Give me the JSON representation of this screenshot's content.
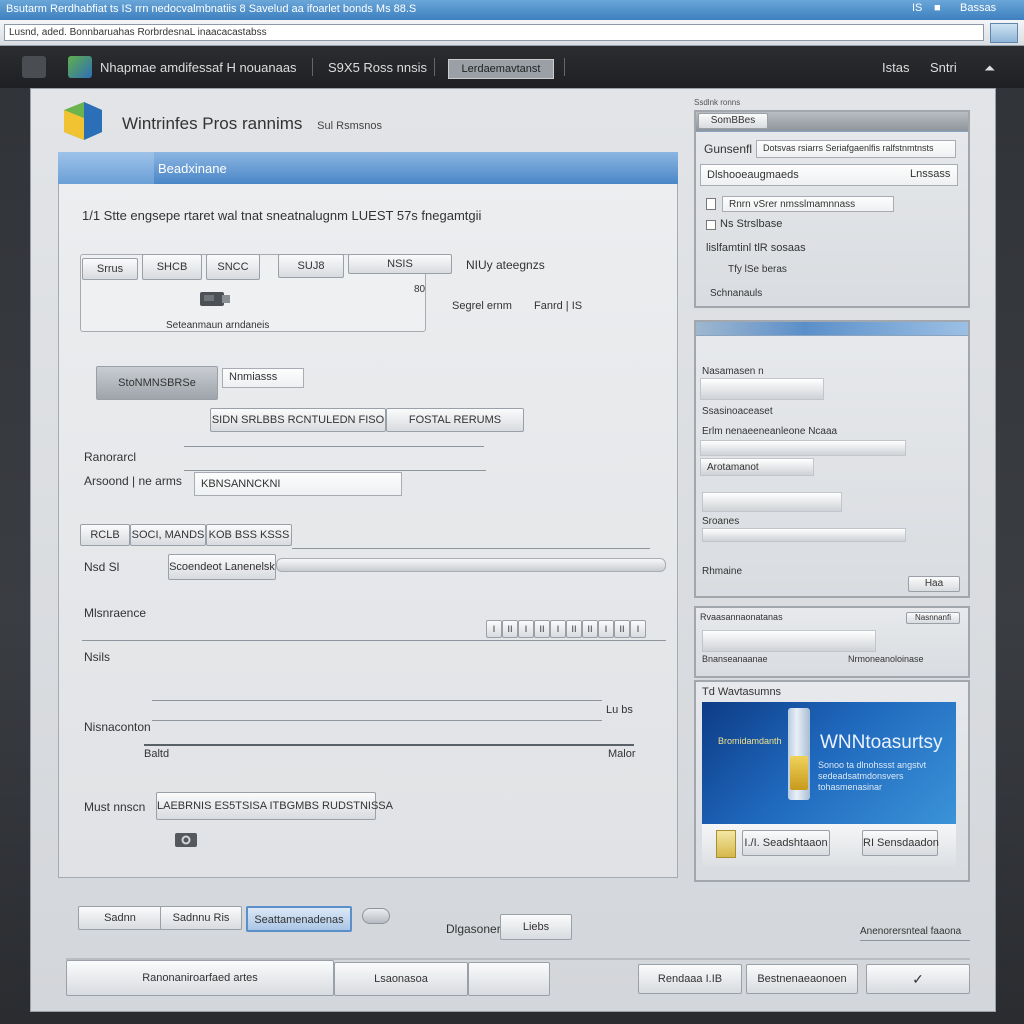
{
  "window": {
    "title": "Bsutarm Rerdhabfiat ts IS rrn nedocvalmbnatiis 8 Savelud aa ifoarlet bonds Ms 88.S",
    "controls": [
      "IS",
      "■",
      "Bassas"
    ],
    "address": "Lusnd, aded. Bonnbaruahas RorbrdesnaL inaacacastabss"
  },
  "toolbar": {
    "app_label": "Nhapmae amdifessaf  H nouanaas",
    "item2": "S9X5 Ross nnsis",
    "badge": "Lerdaemavtanst",
    "right1": "Istas",
    "right2": "Sntri"
  },
  "app": {
    "title": "Wintrinfes Pros rannims",
    "subtitle": "Sul Rsmsnos"
  },
  "left_panel": {
    "header": "Beadxinane",
    "heading": "1/1 Stte engsepe rtaret wal tnat sneatnalugnm LUEST 57s fnegamtgii",
    "tabs": [
      "Srrus",
      "SHCB",
      "SNCC",
      "SUJ8",
      "NSIS"
    ],
    "tabs_note": "NIUy ateegnzs",
    "tabs_meta1": "80",
    "tabs_meta_left": "Segrel ernm",
    "tabs_meta_right": "Fanrd | IS",
    "device_caption": "Seteanmaun arndaneis",
    "row1_button": "StoNMNSBRSe",
    "row1_field": "Nnmiasss",
    "buttons_row2": [
      "SIDN SRLBBS  RCNTULEDN FISO",
      "FOSTAL RERUMS"
    ],
    "label_recorels": "Ranorarcl",
    "label_assoord": "Arsoond | ne arms",
    "field_assoord": "KBNSANNCKNI",
    "mini_tabs": [
      "RCLB",
      "SOCI, MANDS",
      "KOB BSS KSSS"
    ],
    "label_nsd": "Nsd Sl",
    "field_nsd": "Scoendeot Lanenelsk",
    "label_moncones": "Mlsnraence",
    "segments": [
      "I",
      "II",
      "I",
      "II",
      "I",
      "II",
      "II",
      "I",
      "II",
      "I"
    ],
    "label_hso": "Nsils",
    "label_nsnaconton": "Nisnaconton",
    "scroll_label1": "Lu bs",
    "scroll_label2": "Baltd",
    "scroll_label3": "Malor",
    "label_musi": "Must nnscn",
    "field_musi": "LAEBRNIS ES5TSISA ITBGMBS RUDSTNISSA"
  },
  "right_top": {
    "label": "Ssdlnk ronns",
    "tab": "SomBBes",
    "field1_label": "Gunsenfl",
    "field1": "Dotsvas rsiarrs Seriafgaenlfis ralfstnmtnsts",
    "field2": "Dlshooeaugmaeds",
    "field2_right": "Lnssass",
    "option1": "Rnrn vSrer nmsslmamnnass",
    "option2": "Ns Strslbase",
    "option3": "lislfamtinl tlR sosaas",
    "option4": "Tfy lSe beras",
    "option5": "Schnanauls"
  },
  "right_mid": {
    "labels": [
      "Nasamasen n",
      "Ssasinoaceaset",
      "Erlm nenaeeneanleone Ncaaa",
      "Arotamanot",
      "Sroanes",
      "Rhmaine"
    ],
    "button": "Haa"
  },
  "right_bot": {
    "label": "Rvaasannaonatanas",
    "right_label": "Nasnnanfi",
    "sub_left": "Bnanseanaanae",
    "sub_right": "Nrmoneanoloinase"
  },
  "promo": {
    "header": "Td Wavtasumns",
    "brand": "Bromidamdanth",
    "title": "WNNtoasurtsy",
    "subtitle": "Sonoo ta dlnohssst angstvt sedeadsatmdonsvers tohasmenasinar",
    "btn1": "I./I. Seadshtaaon",
    "btn2": "RI Sensdaadon"
  },
  "footer": {
    "tabs": [
      "Sadnn",
      "Sadnnu Ris",
      "Seattamenadenas"
    ],
    "center1": "Dlgasoner",
    "center2": "Liebs",
    "right_text": "Anenorersnteal faaona",
    "bottom_left": "Ranonaniroarfaed artes",
    "bottom_mid": "Lsaonasoa",
    "bottom_right1": "Rendaaa I.IB",
    "bottom_right2": "Bestnenaeaonoen"
  },
  "colors": {
    "accent": "#4a86c7",
    "toolbar_bg": "#1f2023",
    "panel_bg": "#e0e2e5"
  }
}
